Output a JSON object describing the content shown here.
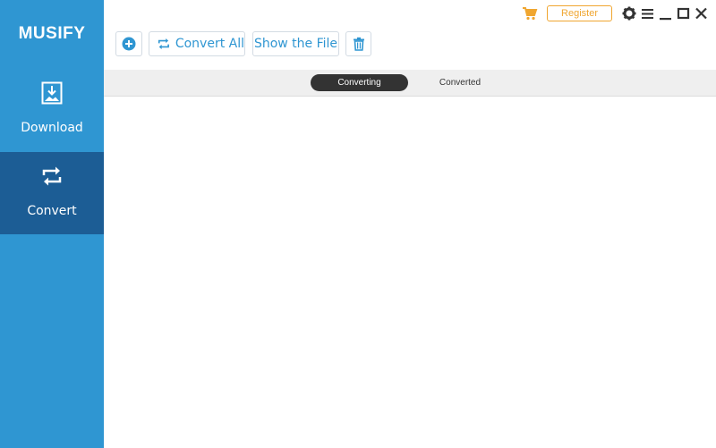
{
  "app": {
    "name": "MUSIFY"
  },
  "sidebar": {
    "items": [
      {
        "label": "Download",
        "icon": "download-icon",
        "active": false
      },
      {
        "label": "Convert",
        "icon": "convert-icon",
        "active": true
      }
    ]
  },
  "toolbar": {
    "add_icon": "plus-circle-icon",
    "convert_all_label": "Convert All",
    "show_file_label": "Show the File",
    "delete_icon": "trash-icon"
  },
  "titlebar": {
    "register_label": "Register",
    "icons": [
      "cart-icon",
      "gear-icon",
      "menu-icon",
      "minimize-icon",
      "maximize-icon",
      "close-icon"
    ]
  },
  "tabs": [
    {
      "label": "Converting",
      "active": true
    },
    {
      "label": "Converted",
      "active": false
    }
  ],
  "colors": {
    "sidebar": "#2f96d2",
    "sidebar_active": "#1c5d95",
    "accent": "#2f96d2",
    "register": "#f0a630",
    "tab_active": "#333333"
  }
}
